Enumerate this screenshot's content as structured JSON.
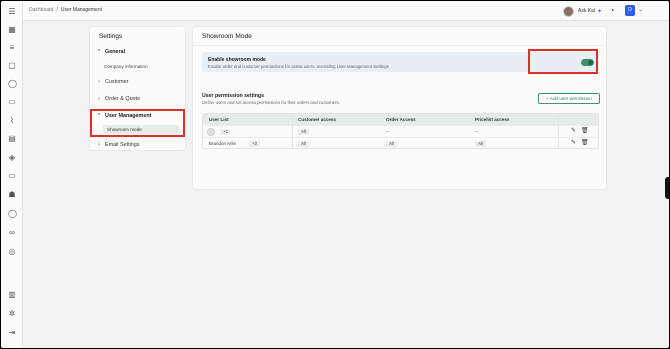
{
  "topbar": {
    "breadcrumb": [
      "Dashboard",
      "User Management"
    ],
    "breadcrumb_sep": "/",
    "ask_label": "Ask Kai",
    "user_initial": "D"
  },
  "rail_icons": [
    "menu-icon",
    "dashboard-icon",
    "list-icon",
    "box-icon",
    "person-icon",
    "chat-icon",
    "chart-icon",
    "clipboard-icon",
    "tag-icon",
    "folder-icon",
    "group-icon",
    "user-icon",
    "link-icon",
    "camera-icon",
    "grid-icon",
    "settings-icon",
    "logout-icon"
  ],
  "settings": {
    "title": "Settings",
    "sections": [
      {
        "label": "General",
        "expanded": true,
        "children": [
          "Company information"
        ]
      },
      {
        "label": "Customer",
        "expanded": false
      },
      {
        "label": "Order & Quote",
        "expanded": false
      },
      {
        "label": "User Management",
        "expanded": true,
        "children": [
          "Showroom mode"
        ]
      },
      {
        "label": "Email Settings",
        "expanded": false
      }
    ]
  },
  "main": {
    "title": "Showroom Mode",
    "showroom": {
      "label": "Enable showroom mode",
      "description": "Enable order and customer permissions for active users, overriding User Management Settings",
      "enabled": true
    },
    "permissions": {
      "title": "User permission settings",
      "subtitle": "Define users and set access permissions for their orders and customers.",
      "add_button": "+ Add user permission",
      "columns": [
        "User List",
        "Customer access",
        "Order Access",
        "Pricelist access"
      ],
      "rows": [
        {
          "user": "",
          "extra": "+1",
          "customer": "All",
          "order": "--",
          "pricelist": "--"
        },
        {
          "user": "Brandon Arlie",
          "extra": "+2",
          "customer": "All",
          "order": "All",
          "pricelist": "All"
        }
      ]
    }
  },
  "colors": {
    "accent": "#3f8f6c",
    "highlight": "#d8332a"
  }
}
